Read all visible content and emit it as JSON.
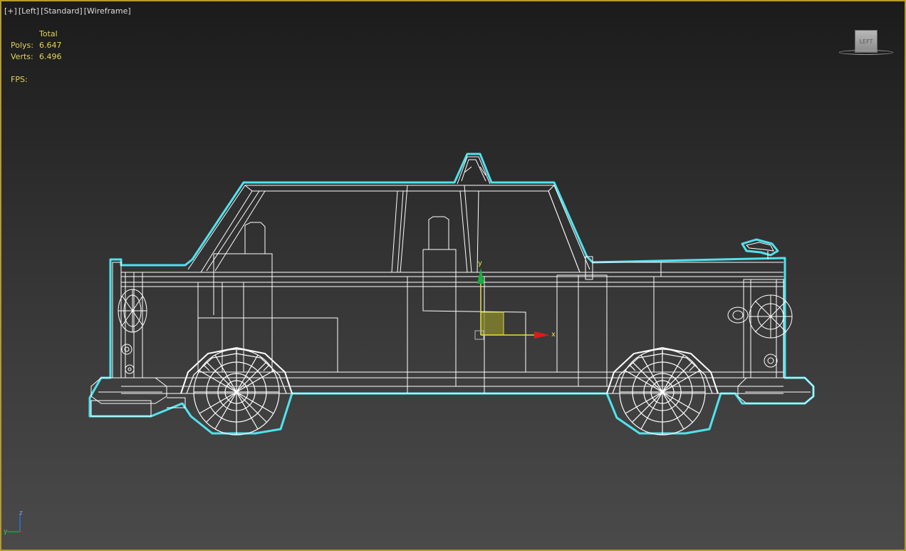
{
  "viewport": {
    "labels": [
      "[+]",
      "[Left]",
      "[Standard]",
      "[Wireframe]"
    ],
    "border_color": "#b79a2a",
    "wire_color": "#ffffff",
    "selection_color": "#4fe3ee"
  },
  "stats": {
    "header": "Total",
    "polys_label": "Polys:",
    "polys_value": "6.647",
    "verts_label": "Verts:",
    "verts_value": "6.496",
    "fps_label": "FPS:"
  },
  "viewcube": {
    "face_label": "LEFT"
  },
  "gizmo": {
    "x_label": "x",
    "y_label": "y"
  },
  "world_axis": {
    "z_label": "z",
    "y_label": "y"
  }
}
